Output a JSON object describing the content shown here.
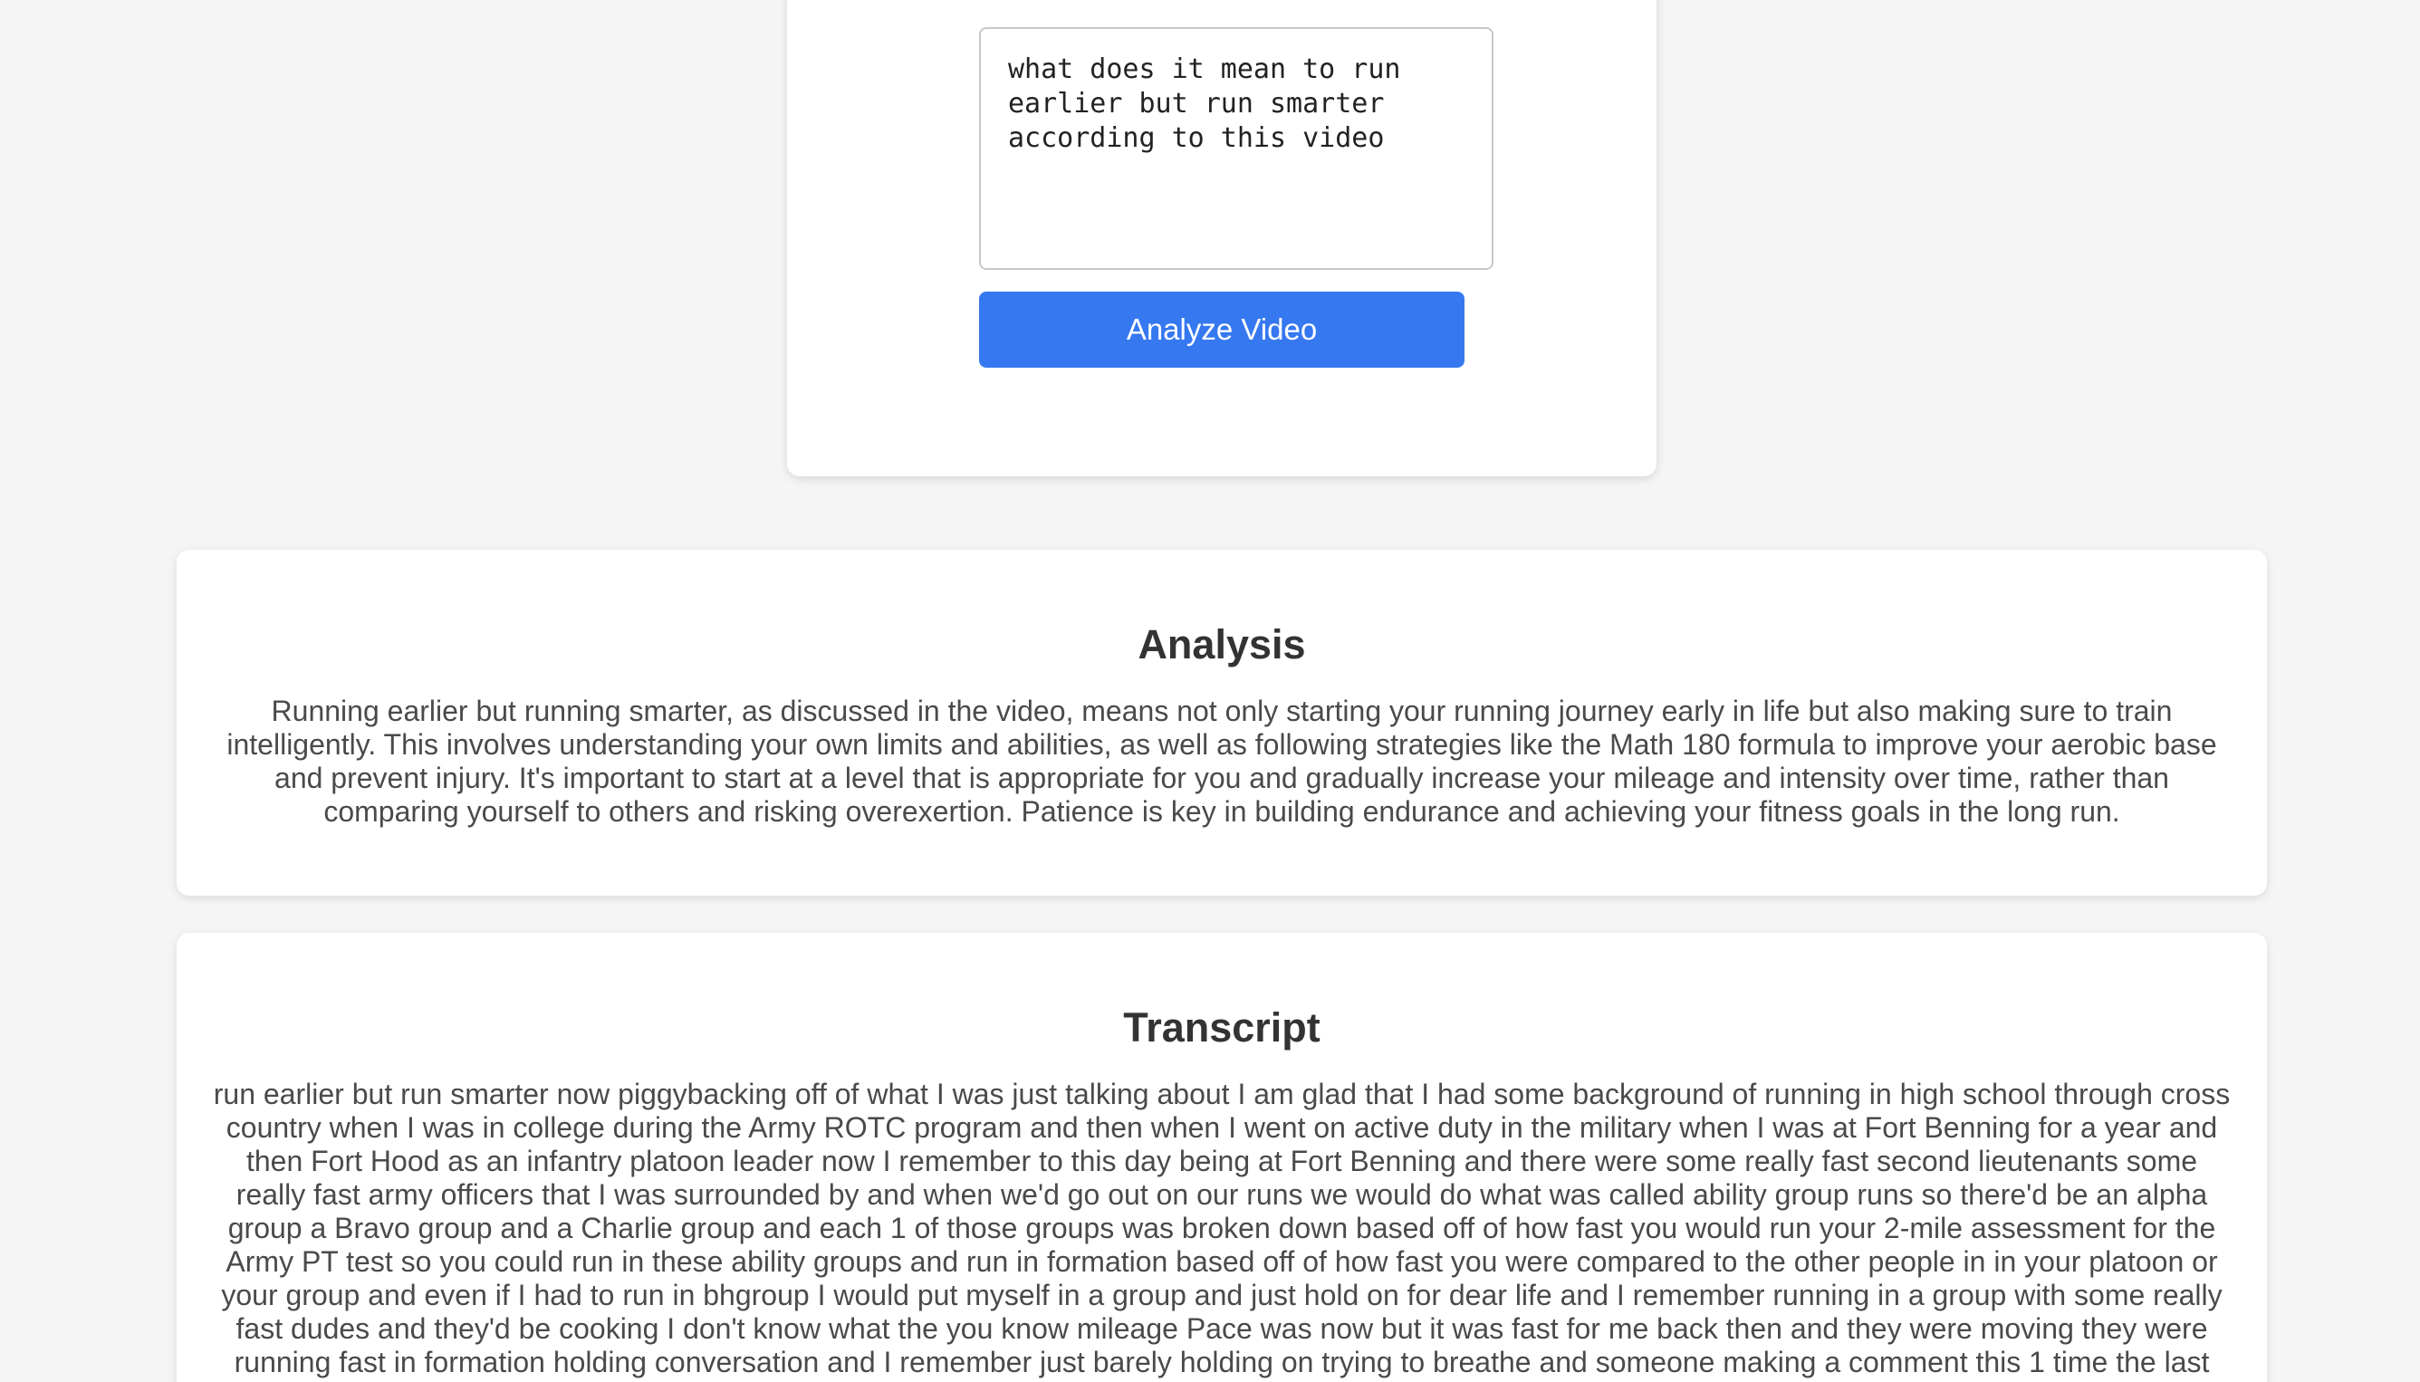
{
  "query": {
    "value": "what does it mean to run earlier but run smarter according to this video"
  },
  "actions": {
    "analyze_label": "Analyze Video"
  },
  "analysis": {
    "heading": "Analysis",
    "text": "Running earlier but running smarter, as discussed in the video, means not only starting your running journey early in life but also making sure to train intelligently. This involves understanding your own limits and abilities, as well as following strategies like the Math 180 formula to improve your aerobic base and prevent injury. It's important to start at a level that is appropriate for you and gradually increase your mileage and intensity over time, rather than comparing yourself to others and risking overexertion. Patience is key in building endurance and achieving your fitness goals in the long run."
  },
  "transcript": {
    "heading": "Transcript",
    "text": "run earlier but run smarter now piggybacking off of what I was just talking about I am glad that I had some background of running in high school through cross country when I was in college during the Army ROTC program and then when I went on active duty in the military when I was at Fort Benning for a year and then Fort Hood as an infantry platoon leader now I remember to this day being at Fort Benning and there were some really fast second lieutenants some really fast army officers that I was surrounded by and when we'd go out on our runs we would do what was called ability group runs so there'd be an alpha group a Bravo group and a Charlie group and each 1 of those groups was broken down based off of how fast you would run your 2-mile assessment for the Army PT test so you could run in these ability groups and run in formation based off of how fast you were compared to the other people in in your platoon or your group and even if I had to run in bhgroup I would put myself in a group and just hold on for dear life and I remember running in a group with some really fast dudes and they'd be cooking I don't know what the you know mileage Pace was now but it was fast for me back then and they were moving they were running fast in formation holding conversation and I remember just barely holding on trying to breathe and someone making a comment this 1 time the last"
  },
  "colors": {
    "background": "#f4f5f4",
    "card": "#ffffff",
    "accent": "#3578f0",
    "heading_text": "#333333",
    "body_text": "#4a4a4a"
  }
}
